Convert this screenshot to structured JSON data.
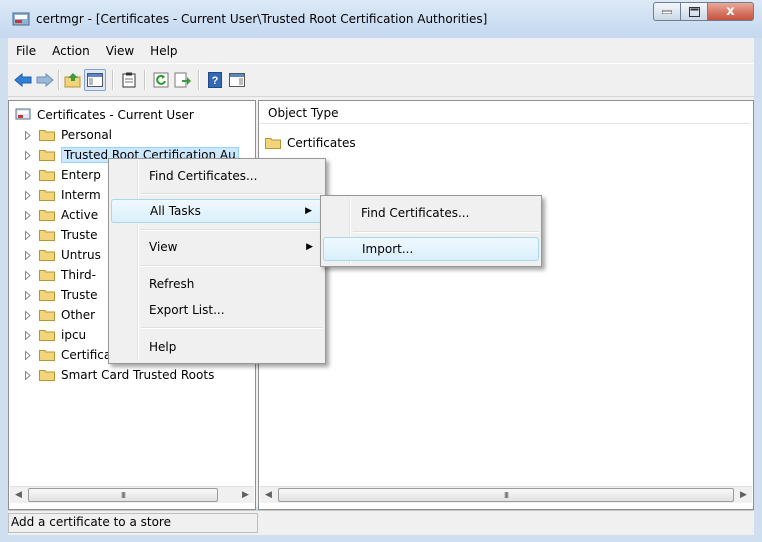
{
  "window": {
    "title": "certmgr - [Certificates - Current User\\Trusted Root Certification Authorities]",
    "close_glyph": "x"
  },
  "menubar": [
    "File",
    "Action",
    "View",
    "Help"
  ],
  "tree": {
    "root": "Certificates - Current User",
    "items": [
      "Personal",
      "Trusted Root Certification Au",
      "Enterp",
      "Interm",
      "Active",
      "Truste",
      "Untrus",
      "Third-",
      "Truste",
      "Other",
      "ipcu",
      "Certificate Enrollment Reques",
      "Smart Card Trusted Roots"
    ]
  },
  "list": {
    "column_header": "Object Type",
    "items": [
      "Certificates"
    ]
  },
  "context_menu": {
    "items": [
      "Find Certificates...",
      "All Tasks",
      "View",
      "Refresh",
      "Export List...",
      "Help"
    ]
  },
  "submenu": {
    "items": [
      "Find Certificates...",
      "Import..."
    ]
  },
  "scroll": {
    "thumb_glyph": "III"
  },
  "status": {
    "text": "Add a certificate to a store"
  },
  "colors": {
    "title_bg": "#c4d8ef",
    "close_red": "#c7503a",
    "selection": "#cce8ff",
    "menu_highlight": "#daf0fc",
    "folder_yellow": "#f2d57a"
  }
}
